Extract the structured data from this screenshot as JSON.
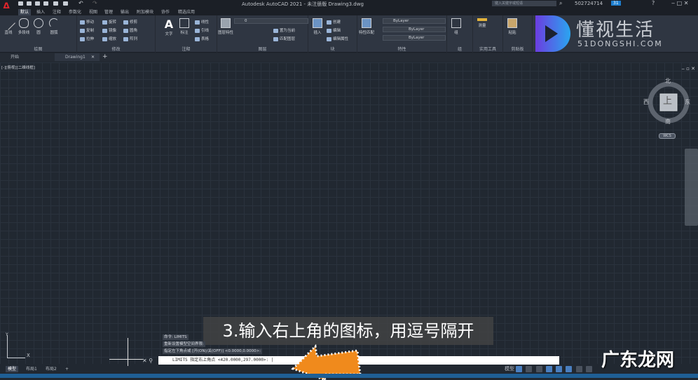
{
  "app": {
    "title": "Autodesk AutoCAD 2021 - 未注册版    Drawing3.dwg",
    "search_placeholder": "键入关键字或短语",
    "user": "502724714",
    "badge": "31"
  },
  "ribbon_tabs": [
    "默认",
    "插入",
    "注释",
    "参数化",
    "视图",
    "管理",
    "输出",
    "附加模块",
    "协作",
    "精选应用"
  ],
  "panels": {
    "draw": {
      "title": "绘图",
      "tools": [
        "直线",
        "多段线",
        "圆",
        "圆弧"
      ]
    },
    "modify": {
      "title": "修改",
      "tools": [
        "移动",
        "旋转",
        "修剪",
        "复制",
        "镜像",
        "圆角",
        "拉伸",
        "缩放",
        "阵列"
      ]
    },
    "annotation": {
      "title": "注释",
      "tools": [
        "文字",
        "标注",
        "线性",
        "引线",
        "表格"
      ]
    },
    "layers": {
      "title": "图层",
      "tools": [
        "图层特性",
        "置为当前",
        "匹配图层"
      ],
      "current_layer": "0"
    },
    "block": {
      "title": "块",
      "tools": [
        "插入",
        "创建",
        "编辑",
        "编辑属性"
      ]
    },
    "properties": {
      "title": "特性",
      "match": "特性匹配",
      "color": "ByLayer",
      "linetype": "ByLayer",
      "lineweight": "ByLayer"
    },
    "groups": {
      "title": "组",
      "tools": [
        "组"
      ]
    },
    "utilities": {
      "title": "实用工具",
      "tools": [
        "测量"
      ]
    },
    "clipboard": {
      "title": "剪贴板",
      "tools": [
        "粘贴"
      ]
    },
    "view": {
      "title": "视图"
    }
  },
  "file_tabs": [
    "开始",
    "Drawing1"
  ],
  "viewport_label": "[-][俯视][二维线框]",
  "viewcube": {
    "top": "上",
    "north": "北",
    "south": "南",
    "east": "东",
    "west": "西",
    "wcs": "WCS"
  },
  "command_history": [
    "命令: LIMITS",
    "重新设置模型空间界限:",
    "指定左下角点或 [开(ON)/关(OFF)] <0.0000,0.0000>:"
  ],
  "command_line": "LIMITS 指定右上角点 <420.0000,297.0000>:",
  "layout_tabs": [
    "模型",
    "布局1",
    "布局2",
    "+"
  ],
  "status": {
    "model": "模型"
  },
  "subtitle": "3.输入右上角的图标，用逗号隔开",
  "watermarks": {
    "brand": "懂视生活",
    "brand_url": "51DONGSHI.COM",
    "site": "广东龙网"
  },
  "colors": {
    "accent": "#1f5f95",
    "arrow": "#f08a1c",
    "autocad_red": "#e0252b"
  }
}
